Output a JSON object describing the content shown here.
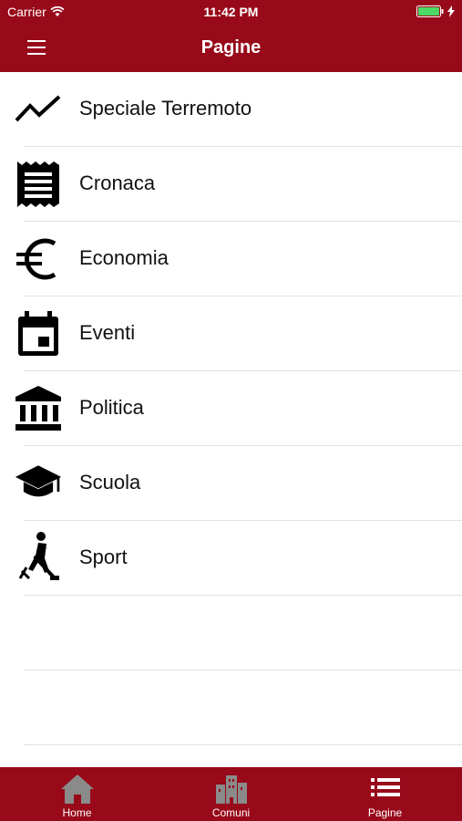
{
  "status": {
    "carrier": "Carrier",
    "time": "11:42 PM"
  },
  "navbar": {
    "title": "Pagine",
    "menu_icon": "hamburger-icon"
  },
  "list": {
    "items": [
      {
        "label": "Speciale Terremoto",
        "icon": "trend-line-icon"
      },
      {
        "label": "Cronaca",
        "icon": "receipt-icon"
      },
      {
        "label": "Economia",
        "icon": "euro-icon"
      },
      {
        "label": "Eventi",
        "icon": "calendar-icon"
      },
      {
        "label": "Politica",
        "icon": "institution-icon"
      },
      {
        "label": "Scuola",
        "icon": "graduation-cap-icon"
      },
      {
        "label": "Sport",
        "icon": "hockey-player-icon"
      }
    ]
  },
  "tabbar": {
    "tabs": [
      {
        "label": "Home",
        "icon": "home-icon"
      },
      {
        "label": "Comuni",
        "icon": "city-icon"
      },
      {
        "label": "Pagine",
        "icon": "list-icon"
      }
    ]
  },
  "colors": {
    "brand": "#98091a",
    "inactive_tab_icon": "#8a8a8a"
  }
}
